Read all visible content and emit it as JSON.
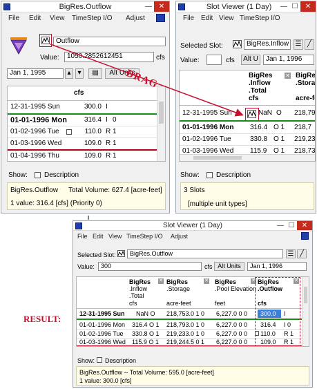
{
  "left_window": {
    "title": "BigRes.Outflow",
    "menus": [
      "File",
      "Edit",
      "View",
      "TimeStep I/O",
      "Adjust"
    ],
    "slot_name": "Outflow",
    "value_label": "Value:",
    "value": "1050.2852612451",
    "value_unit": "cfs",
    "date": "Jan 1, 1995",
    "alt_units": "Alt Units",
    "column_unit": "cfs",
    "rows": [
      {
        "date": "12-31-1995 Sun",
        "value": "300.0",
        "flag": "I",
        "priority": "",
        "bold": false
      },
      {
        "date": "01-01-1996 Mon",
        "value": "316.4",
        "flag": "I",
        "priority": "0",
        "bold": true
      },
      {
        "date": "01-02-1996 Tue",
        "value": "110.0",
        "flag": "R",
        "priority": "1",
        "bold": false
      },
      {
        "date": "01-03-1996 Wed",
        "value": "109.0",
        "flag": "R",
        "priority": "1",
        "bold": false
      },
      {
        "date": "01-04-1996 Thu",
        "value": "109.0",
        "flag": "R",
        "priority": "1",
        "bold": false
      }
    ],
    "show_label": "Show:",
    "description_label": "Description",
    "status_name": "BigRes.Outflow",
    "status_volume": "Total Volume: 627.4 [acre-feet]",
    "status_value": "1 value: 316.4 [cfs] (Priority 0)"
  },
  "right_window": {
    "title": "Slot Viewer (1 Day)",
    "menus": [
      "File",
      "Edit",
      "View",
      "TimeStep I/O"
    ],
    "selected_slot_label": "Selected Slot:",
    "selected_slot": "BigRes.Inflow",
    "value_label": "Value:",
    "value_unit": "cfs",
    "alt_units": "Alt U",
    "date": "Jan 1, 1996",
    "columns": [
      {
        "line1": "BigRes",
        "line2": ".Inflow",
        "line3": ".Total",
        "unit": "cfs"
      },
      {
        "line1": "BigRes",
        "line2": ".Storage",
        "line3": "",
        "unit": "acre-feet"
      }
    ],
    "rows": [
      {
        "date": "12-31-1995 Sun",
        "c1": "NaN",
        "c1f": "O",
        "c2": "218,79",
        "bold": false
      },
      {
        "date": "01-01-1996 Mon",
        "c1": "316.4",
        "c1f": "O 1",
        "c2": "218,7",
        "bold": true
      },
      {
        "date": "01-02-1996 Tue",
        "c1": "330.8",
        "c1f": "O 1",
        "c2": "219,23",
        "bold": false
      },
      {
        "date": "01-03-1996 Wed",
        "c1": "115.9",
        "c1f": "O 1",
        "c2": "218,73",
        "bold": false
      }
    ],
    "show_label": "Show:",
    "description_label": "Description",
    "status_count": "3 Slots",
    "status_units": "[multiple unit types]"
  },
  "drag_label": "DRAG",
  "result_label": "RESULT:",
  "result_window": {
    "title": "Slot Viewer (1 Day)",
    "menus": [
      "File",
      "Edit",
      "View",
      "TimeStep I/O",
      "Adjust"
    ],
    "selected_slot_label": "Selected Slot:",
    "selected_slot": "BigRes.Outflow",
    "value_label": "Value:",
    "value": "300",
    "value_unit": "cfs",
    "alt_units": "Alt Units",
    "date": "Jan 1, 1996",
    "columns": [
      {
        "line1": "BigRes",
        "line2": ".Inflow",
        "line3": ".Total",
        "unit": "cfs"
      },
      {
        "line1": "BigRes",
        "line2": ".Storage",
        "line3": "",
        "unit": "acre-feet"
      },
      {
        "line1": "BigRes",
        "line2": ".Pool Elevation",
        "line3": "",
        "unit": "feet"
      },
      {
        "line1": "BigRes",
        "line2": ".Outflow",
        "line3": "",
        "unit": "cfs"
      }
    ],
    "rows": [
      {
        "date": "12-31-1995 Sun",
        "c1": "NaN O",
        "c2": "218,753.0 1 0",
        "c3": "6,227.0 0 0",
        "c4": "300.0",
        "c4f": "I",
        "bold": true
      },
      {
        "date": "01-01-1996 Mon",
        "c1": "316.4 O 1",
        "c2": "218,793.0 1 0",
        "c3": "6,227.0 0 0",
        "c4": "316.4",
        "c4f": "I 0",
        "bold": false
      },
      {
        "date": "01-02-1996 Tue",
        "c1": "330.8 O 1",
        "c2": "219,233.0 1 0",
        "c3": "6,227.0 0 0",
        "c4": "110.0",
        "c4f": "R 1",
        "bold": false
      },
      {
        "date": "01-03-1996 Wed",
        "c1": "115.9 O 1",
        "c2": "219,244.5 0 1",
        "c3": "6,227.0 0 0",
        "c4": "109.0",
        "c4f": "R 1",
        "bold": false
      }
    ],
    "show_label": "Show:",
    "description_label": "Description",
    "status_name": "BigRes.Outflow -- Total Volume: 595.0 [acre-feet]",
    "status_value": "1 value: 300.0 [cfs]"
  },
  "colors": {
    "accent_red": "#c8102e",
    "ok_green": "#1a8a1a",
    "title_blue": "#1f3fae",
    "highlight_blue": "#3c7fd8"
  }
}
